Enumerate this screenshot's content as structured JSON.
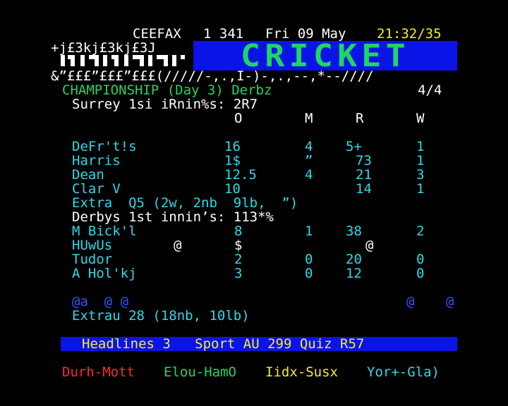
{
  "header": {
    "service": "CEEFAX",
    "page": "1 341",
    "date": "Fri 09 May",
    "time": "21:32/35"
  },
  "banner": {
    "garble_line1": "+j£3kj£3kj£3J",
    "title": "CRICKET",
    "garble_line2": "&”£££”£££”£££(/////-,.,I-)-,.,--,*--////"
  },
  "match": {
    "title": "CHAMPIONSHIP (Day 3) Derbz",
    "page_count": "4/4",
    "innings1_title": "Surrey 1si iRnin%s: 2R7",
    "columns": [
      "O",
      "M",
      "R",
      "W"
    ],
    "innings1_rows": [
      {
        "name": "DeFr't!s",
        "o": "16",
        "m": "4",
        "r": "5+",
        "w": "1"
      },
      {
        "name": "Harris",
        "o": "1$",
        "m": "”",
        "r": "73",
        "w": "1"
      },
      {
        "name": "Dean",
        "o": "12.5",
        "m": "4",
        "r": "21",
        "w": "3"
      },
      {
        "name": "Clar V",
        "o": "10",
        "m": "",
        "r": "14",
        "w": "1"
      }
    ],
    "innings1_extras": "Extra  Q5 (2w, 2nb  9lb,  ”)",
    "innings2_title": "Derbys 1st innin’s: 113*%",
    "innings2_rows": [
      {
        "name": "M Bick'l",
        "o": "8",
        "m": "1",
        "r": "38",
        "w": "2"
      },
      {
        "name": "HUwUs",
        "at": "@",
        "o": "$",
        "m": "",
        "r": "@",
        "w": ""
      },
      {
        "name": "Tudor",
        "o": "2",
        "m": "0",
        "r": "20",
        "w": "0"
      },
      {
        "name": "A Hol'kj",
        "o": "3",
        "m": "0",
        "r": "12",
        "w": "0"
      }
    ],
    "garble_row": {
      "left": "@a  @ @",
      "right1": "@",
      "right2": "@"
    },
    "innings2_extras": "Extrau 28 (18nb, 10lb)"
  },
  "footer_nav": {
    "text": "Headlines 3   Sport AU 299 Quiz R57"
  },
  "fastext": {
    "red": "Durh-Mott",
    "green": "Elou-HamO",
    "yellow": "Iidx-Susx",
    "cyan": "Yor+-Gla)"
  },
  "colors": {
    "background": "#000000",
    "white": "#ffffff",
    "cyan": "#2fd8e8",
    "green": "#1ed760",
    "yellow": "#f5ee28",
    "blue": "#0a14e6",
    "red": "#ff2a2a"
  }
}
